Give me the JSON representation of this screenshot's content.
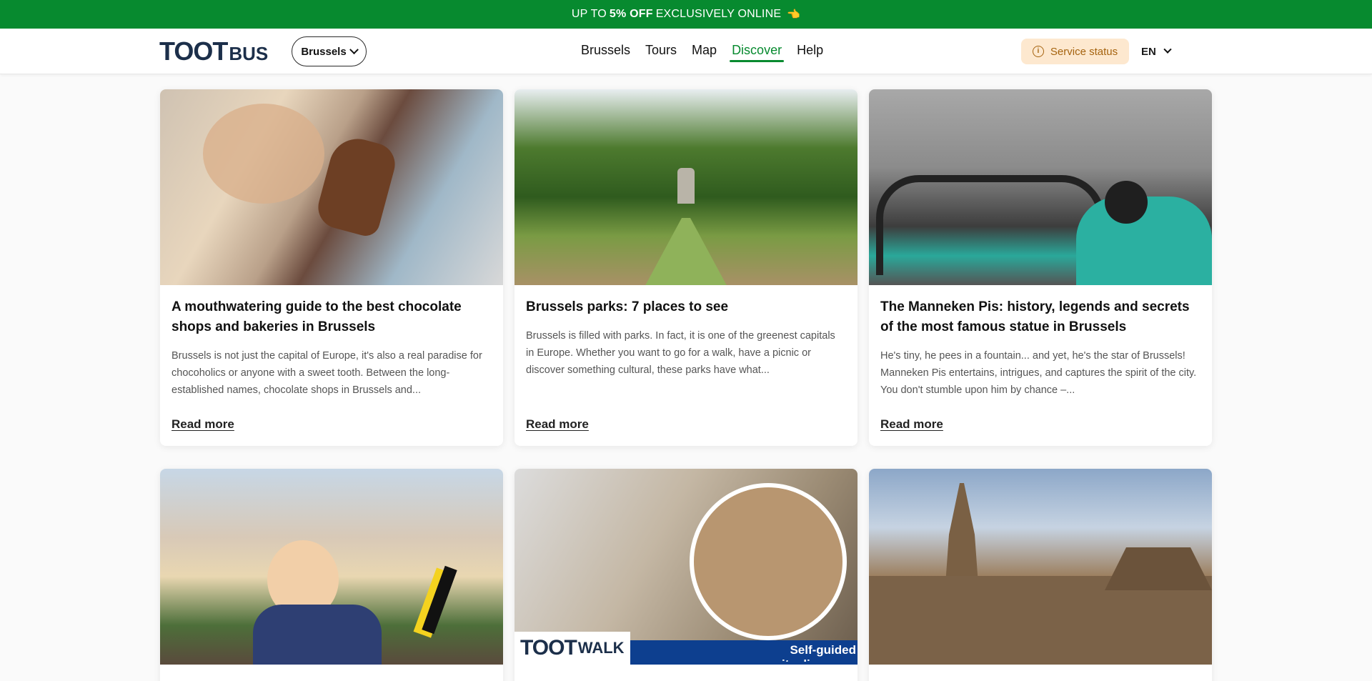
{
  "promo": {
    "prefix": "UP TO",
    "highlight": "5% OFF",
    "suffix": "EXCLUSIVELY ONLINE",
    "icon": "pointing-hand-icon"
  },
  "header": {
    "logo_main": "TOOT",
    "logo_sub": "BUS",
    "city_select": "Brussels",
    "nav": [
      "Brussels",
      "Tours",
      "Map",
      "Discover",
      "Help"
    ],
    "active_nav": "Discover",
    "service_status": "Service status",
    "language": "EN"
  },
  "colors": {
    "brand_green": "#078a2f",
    "status_bg": "#fde8cf",
    "status_text": "#a5630f",
    "logo_navy": "#1c2f4a"
  },
  "cards": [
    {
      "title": "A mouthwatering guide to the best chocolate shops and bakeries in Brussels",
      "excerpt": "Brussels is not just the capital of Europe, it's also a real paradise for chocoholics or anyone with a sweet tooth. Between the long-established names, chocolate shops in Brussels and...",
      "link": "Read more"
    },
    {
      "title": "Brussels parks: 7 places to see",
      "excerpt": "Brussels is filled with parks. In fact, it is one of the greenest capitals in Europe. Whether you want to go for a walk, have a picnic or discover something cultural, these parks have what...",
      "link": "Read more"
    },
    {
      "title": "The Manneken Pis: history, legends and secrets of the most famous statue in Brussels",
      "excerpt": "He's tiny, he pees in a fountain... and yet, he's the star of Brussels! Manneken Pis entertains, intrigues, and captures the spirit of the city. You don't stumble upon him by chance –...",
      "link": "Read more"
    }
  ],
  "walk_banner": {
    "logo_main": "TOOT",
    "logo_sub": "WALK",
    "tagline": "Self-guided city discovery"
  }
}
